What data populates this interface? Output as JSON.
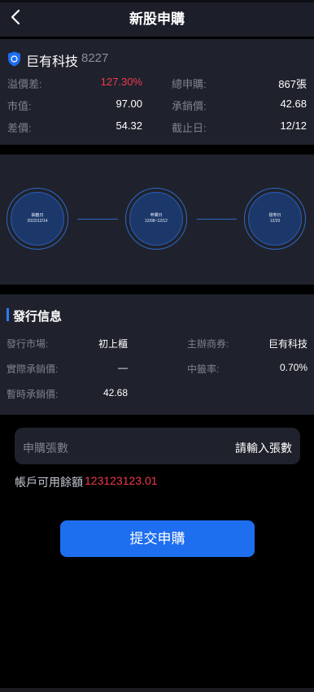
{
  "header": {
    "title": "新股申購"
  },
  "stock": {
    "name": "巨有科技",
    "code": "8227",
    "rows": [
      {
        "l1": "溢價差:",
        "v1": "127.30%",
        "l2": "總申購:",
        "v2": "867張"
      },
      {
        "l1": "市值:",
        "v1": "97.00",
        "l2": "承銷價:",
        "v2": "42.68"
      },
      {
        "l1": "差價:",
        "v1": "54.32",
        "l2": "截止日:",
        "v2": "12/12"
      }
    ]
  },
  "timeline": [
    {
      "title": "抽籤日",
      "date": "2022/12/14"
    },
    {
      "title": "申購日",
      "date": "12/08~12/12"
    },
    {
      "title": "撥券日",
      "date": "12/20"
    }
  ],
  "issue": {
    "title": "發行信息",
    "rows": [
      {
        "l1": "發行市場:",
        "v1": "初上櫃",
        "l2": "主辦商券:",
        "v2": "巨有科技"
      },
      {
        "l1": "實際承銷價:",
        "v1": "—",
        "l2": "中籤率:",
        "v2": "0.70%"
      },
      {
        "l1": "暫時承銷價:",
        "v1": "42.68"
      }
    ]
  },
  "form": {
    "quantity_label": "申購張數",
    "quantity_placeholder": "請輸入張數",
    "balance_label": "帳戶可用餘額",
    "balance_value": "123123123.01"
  },
  "submit_label": "提交申購",
  "colors": {
    "accent": "#1e6ef0",
    "red": "#f0394e",
    "panel": "#1f222c",
    "ring": "#2f68c9"
  },
  "icons": {
    "back": "chevron-left-icon",
    "stock_logo": "shield-logo-icon"
  }
}
